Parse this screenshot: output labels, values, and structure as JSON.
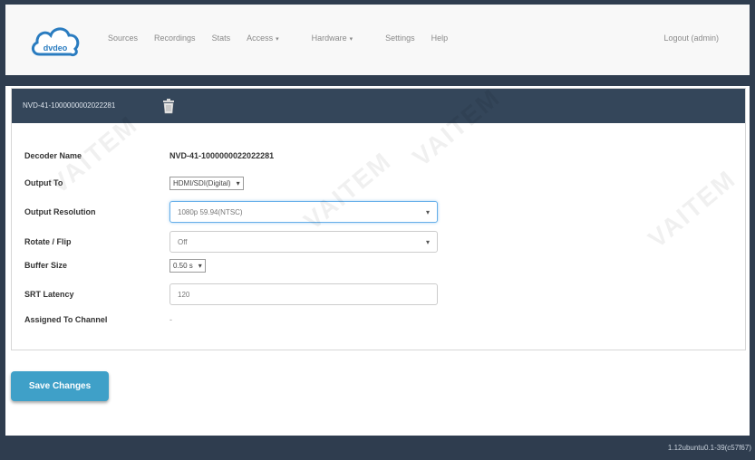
{
  "brand": {
    "logo_text": "dvdeo"
  },
  "nav": {
    "items": [
      {
        "label": "Sources",
        "dropdown": false
      },
      {
        "label": "Recordings",
        "dropdown": false
      },
      {
        "label": "Stats",
        "dropdown": false
      },
      {
        "label": "Access",
        "dropdown": true
      },
      {
        "label": "Hardware",
        "dropdown": true
      },
      {
        "label": "Settings",
        "dropdown": false
      },
      {
        "label": "Help",
        "dropdown": false
      }
    ],
    "logout": "Logout (admin)"
  },
  "panel": {
    "title": "NVD-41-1000000002022281",
    "icon": "trash-icon"
  },
  "form": {
    "decoder_name": {
      "label": "Decoder Name",
      "value": "NVD-41-1000000022022281"
    },
    "output_to": {
      "label": "Output To",
      "value": "HDMI/SDI(Digital)"
    },
    "output_resolution": {
      "label": "Output Resolution",
      "value": "1080p 59.94(NTSC)"
    },
    "rotate_flip": {
      "label": "Rotate / Flip",
      "value": "Off"
    },
    "buffer_size": {
      "label": "Buffer Size",
      "value": "0.50 s"
    },
    "srt_latency": {
      "label": "SRT Latency",
      "value": "120"
    },
    "assigned_channel": {
      "label": "Assigned To Channel",
      "value": "-"
    }
  },
  "actions": {
    "save_label": "Save Changes"
  },
  "footer": {
    "version": "1.12ubuntu0.1-39(c57f67)"
  },
  "watermark": {
    "text": "VAITEM"
  },
  "colors": {
    "dark_bar": "#2f3d4f",
    "panel_header": "#34465a",
    "save_button": "#3fa0c8",
    "focus_border": "#66afe9"
  }
}
